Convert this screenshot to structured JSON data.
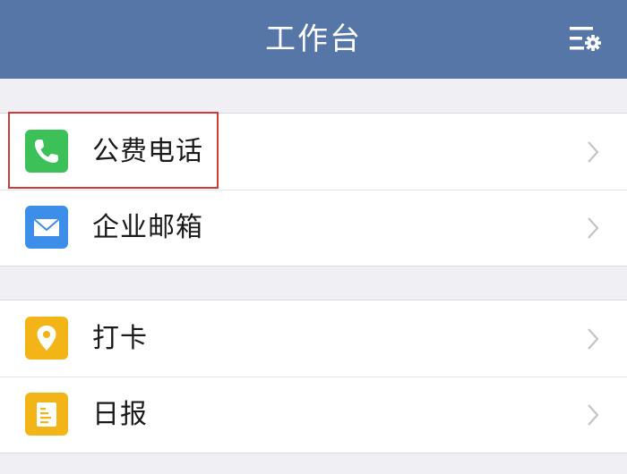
{
  "header": {
    "title": "工作台"
  },
  "groups": [
    {
      "items": [
        {
          "label": "公费电话",
          "icon": "phone-icon",
          "color": "#3cc159"
        },
        {
          "label": "企业邮箱",
          "icon": "mail-icon",
          "color": "#3d8ee8"
        }
      ]
    },
    {
      "items": [
        {
          "label": "打卡",
          "icon": "location-pin-icon",
          "color": "#f2b416"
        },
        {
          "label": "日报",
          "icon": "report-icon",
          "color": "#f2b416"
        }
      ]
    }
  ],
  "colors": {
    "header_bg": "#5576a7",
    "highlight": "#d33a3a"
  }
}
